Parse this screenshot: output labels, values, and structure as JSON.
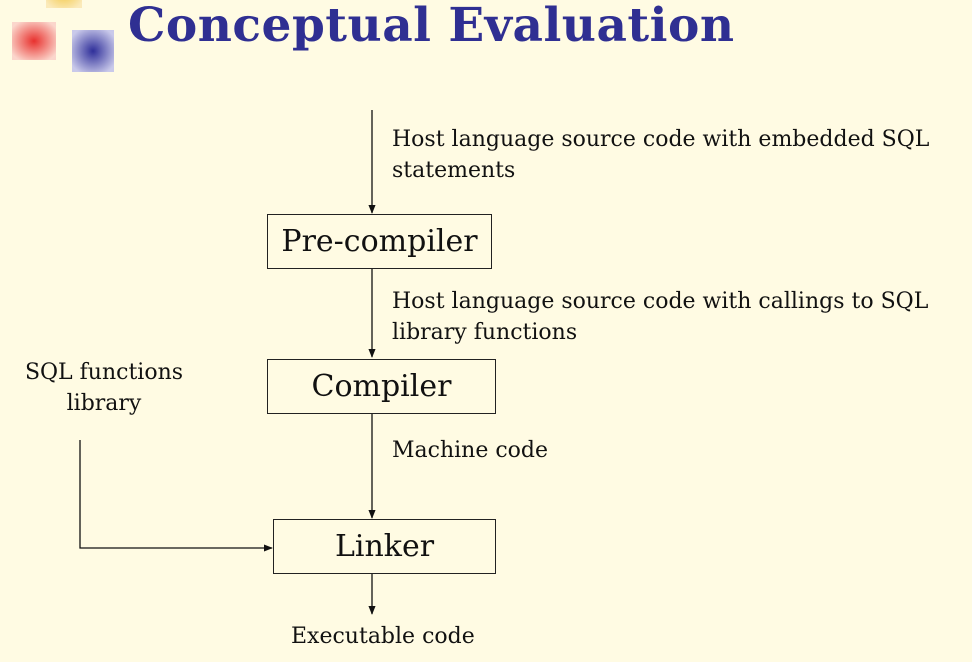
{
  "title": "Conceptual Evaluation",
  "nodes": {
    "precompiler": "Pre-compiler",
    "compiler": "Compiler",
    "linker": "Linker"
  },
  "labels": {
    "input_line1": "Host language source code with embedded SQL",
    "input_line2": "statements",
    "precomp_out_line1": "Host language source code with callings to SQL",
    "precomp_out_line2": "library functions",
    "compiler_out": "Machine code",
    "library_line1": "SQL functions",
    "library_line2": "library",
    "output": "Executable code"
  },
  "colors": {
    "background": "#fffbe3",
    "title": "#2f2f92",
    "logo_red": "#e8312e",
    "logo_blue": "#2f2f9a",
    "logo_yellow": "#f2c53d"
  }
}
